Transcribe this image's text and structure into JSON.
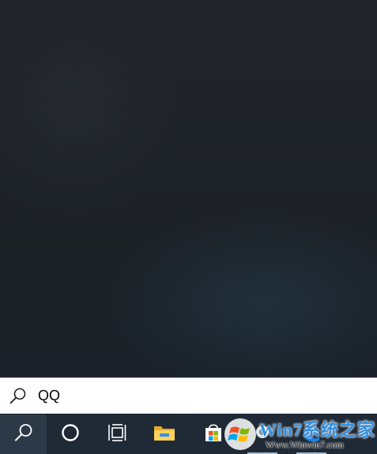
{
  "search": {
    "query": "QQ"
  },
  "taskbar": {
    "items": [
      {
        "name": "search",
        "icon": "search-icon",
        "active": true
      },
      {
        "name": "cortana",
        "icon": "cortana-circle-icon"
      },
      {
        "name": "task-view",
        "icon": "task-view-icon"
      },
      {
        "name": "file-explorer",
        "icon": "folder-icon"
      },
      {
        "name": "microsoft-store",
        "icon": "store-bag-icon"
      },
      {
        "name": "running-app",
        "icon": "app-icon"
      },
      {
        "name": "edge",
        "icon": "edge-icon"
      }
    ]
  },
  "watermark": {
    "title": "Win7系统之家",
    "url": "Www.Winwin7.com"
  },
  "colors": {
    "taskbar": "#1f2a36",
    "search_background": "#ffffff",
    "accent": "#2f8ee0"
  }
}
